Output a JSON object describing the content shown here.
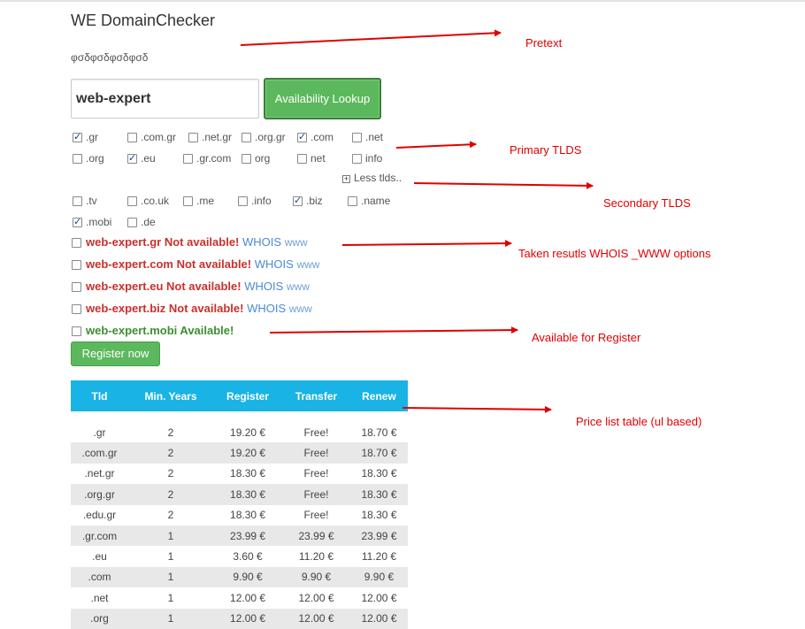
{
  "app": {
    "title": "WE DomainChecker",
    "pretext": "φσδφσδφσδφσδ"
  },
  "search": {
    "value": "web-expert",
    "button_label": "Availability Lookup"
  },
  "primary_tlds": [
    {
      "label": ".gr",
      "checked": true
    },
    {
      "label": ".com.gr",
      "checked": false
    },
    {
      "label": ".net.gr",
      "checked": false
    },
    {
      "label": ".org.gr",
      "checked": false
    },
    {
      "label": ".com",
      "checked": true
    },
    {
      "label": ".net",
      "checked": false
    },
    {
      "label": ".org",
      "checked": false
    },
    {
      "label": ".eu",
      "checked": true
    },
    {
      "label": ".gr.com",
      "checked": false
    },
    {
      "label": "org",
      "checked": false
    },
    {
      "label": "net",
      "checked": false
    },
    {
      "label": "info",
      "checked": false
    }
  ],
  "toggle_label": "Less tlds..",
  "secondary_tlds": [
    {
      "label": ".tv",
      "checked": false
    },
    {
      "label": ".co.uk",
      "checked": false
    },
    {
      "label": ".me",
      "checked": false
    },
    {
      "label": ".info",
      "checked": false
    },
    {
      "label": ".biz",
      "checked": true
    },
    {
      "label": ".name",
      "checked": false
    },
    {
      "label": ".mobi",
      "checked": true
    },
    {
      "label": ".de",
      "checked": false
    }
  ],
  "results": [
    {
      "text": "web-expert.gr Not available!",
      "whois": "WHOIS",
      "www": "www"
    },
    {
      "text": "web-expert.com Not available!",
      "whois": "WHOIS",
      "www": "www"
    },
    {
      "text": "web-expert.eu Not available!",
      "whois": "WHOIS",
      "www": "www"
    },
    {
      "text": "web-expert.biz Not available!",
      "whois": "WHOIS",
      "www": "www"
    },
    {
      "text": "web-expert.mobi Available!"
    }
  ],
  "register_label": "Register now",
  "price_table": {
    "headers": [
      "Tld",
      "Min. Years",
      "Register",
      "Transfer",
      "Renew"
    ],
    "rows": [
      [
        ".gr",
        "2",
        "19.20 €",
        "Free!",
        "18.70 €"
      ],
      [
        ".com.gr",
        "2",
        "19.20 €",
        "Free!",
        "18.70 €"
      ],
      [
        ".net.gr",
        "2",
        "18.30 €",
        "Free!",
        "18.30 €"
      ],
      [
        ".org.gr",
        "2",
        "18.30 €",
        "Free!",
        "18.30 €"
      ],
      [
        ".edu.gr",
        "2",
        "18.30 €",
        "Free!",
        "18.30 €"
      ],
      [
        ".gr.com",
        "1",
        "23.99 €",
        "23.99 €",
        "23.99 €"
      ],
      [
        ".eu",
        "1",
        "3.60 €",
        "11.20 €",
        "11.20 €"
      ],
      [
        ".com",
        "1",
        "9.90 €",
        "9.90 €",
        "9.90 €"
      ],
      [
        ".net",
        "1",
        "12.00 €",
        "12.00 €",
        "12.00 €"
      ],
      [
        ".org",
        "1",
        "12.00 €",
        "12.00 €",
        "12.00 €"
      ]
    ]
  },
  "annotations": {
    "pretext": "Pretext",
    "primary": "Primary TLDS",
    "secondary": "Secondary TLDS",
    "taken": "Taken resutls WHOIS _WWW options",
    "available": "Available for Register",
    "pricelist": "Price list table (ul based)"
  },
  "colors": {
    "annotation": "#e00000",
    "accent_button": "#5cb85c",
    "table_header": "#19b3e6",
    "taken": "#c9302c",
    "available": "#3c8f2f"
  }
}
